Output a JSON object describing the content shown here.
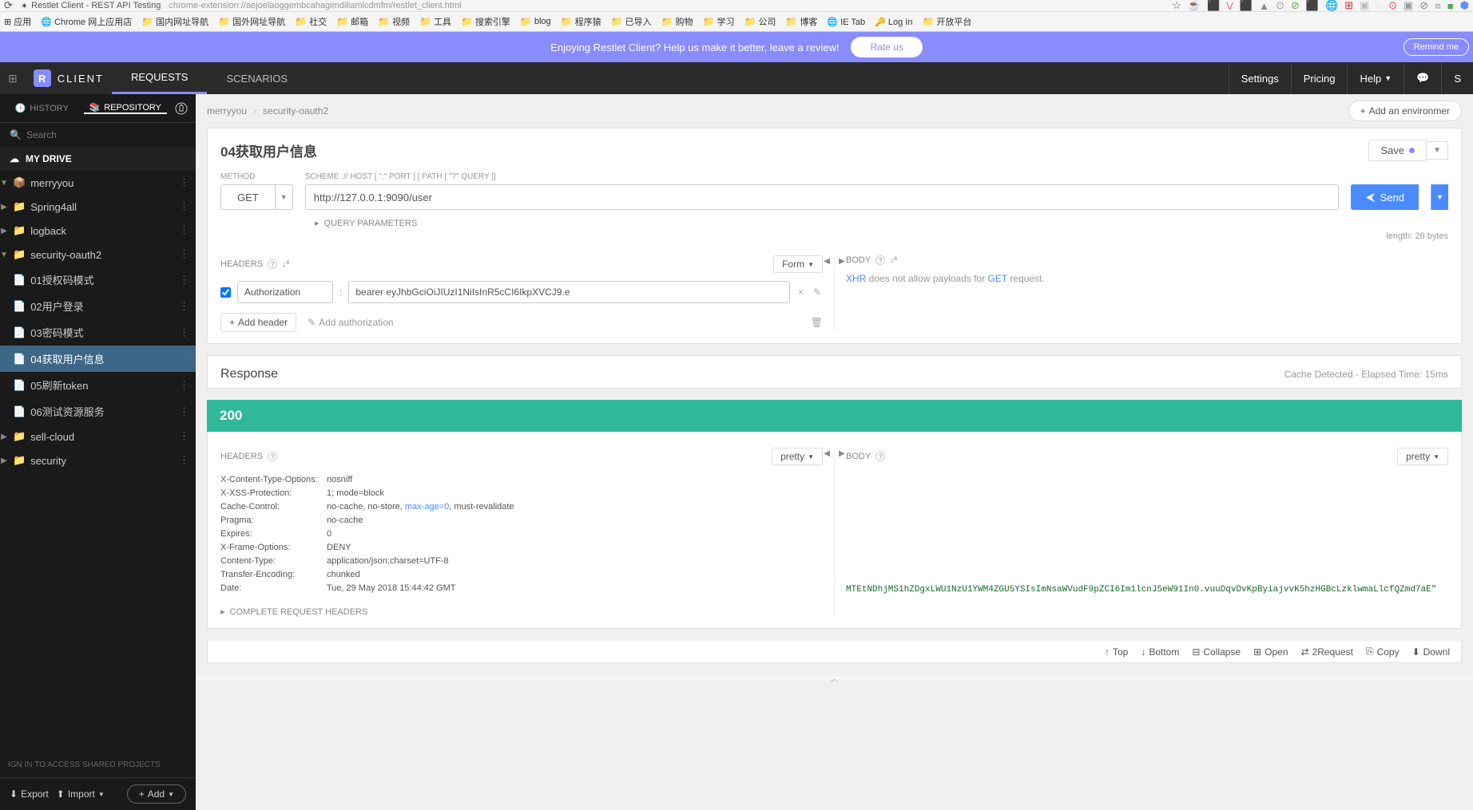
{
  "browser": {
    "title": "Restlet Client - REST API Testing",
    "url": "chrome-extension://aejoelaoggembcahagimdiliamlcdmfm/restlet_client.html"
  },
  "bookmarks": [
    {
      "icon": "apps",
      "label": "应用"
    },
    {
      "icon": "chrome",
      "label": "Chrome 网上应用店"
    },
    {
      "icon": "folder",
      "label": "国内网址导航"
    },
    {
      "icon": "folder",
      "label": "国外网址导航"
    },
    {
      "icon": "folder",
      "label": "社交"
    },
    {
      "icon": "folder",
      "label": "邮箱"
    },
    {
      "icon": "folder",
      "label": "视频"
    },
    {
      "icon": "folder",
      "label": "工具"
    },
    {
      "icon": "folder",
      "label": "搜索引擎"
    },
    {
      "icon": "folder",
      "label": "blog"
    },
    {
      "icon": "folder",
      "label": "程序猿"
    },
    {
      "icon": "folder",
      "label": "已导入"
    },
    {
      "icon": "folder",
      "label": "购物"
    },
    {
      "icon": "folder",
      "label": "学习"
    },
    {
      "icon": "folder",
      "label": "公司"
    },
    {
      "icon": "folder",
      "label": "博客"
    },
    {
      "icon": "ie",
      "label": "IE Tab"
    },
    {
      "icon": "login",
      "label": "Log In"
    },
    {
      "icon": "folder",
      "label": "开放平台"
    }
  ],
  "banner": {
    "text": "Enjoying Restlet Client? Help us make it better, leave a review!",
    "rate": "Rate us",
    "remind": "Remind me"
  },
  "topnav": {
    "client": "CLIENT",
    "tabs": [
      "REQUESTS",
      "SCENARIOS"
    ],
    "right": [
      "Settings",
      "Pricing",
      "Help"
    ]
  },
  "sidebar": {
    "history": "HISTORY",
    "repository": "REPOSITORY",
    "search_placeholder": "Search",
    "drive": "MY DRIVE",
    "signin": "IGN IN TO ACCESS SHARED PROJECTS",
    "export": "Export",
    "import": "Import",
    "add": "Add",
    "tree": [
      {
        "level": 1,
        "type": "proj",
        "label": "merryyou",
        "open": true
      },
      {
        "level": 2,
        "type": "folder",
        "label": "Spring4all",
        "open": false
      },
      {
        "level": 2,
        "type": "folder",
        "label": "logback",
        "open": false
      },
      {
        "level": 2,
        "type": "folder",
        "label": "security-oauth2",
        "open": true
      },
      {
        "level": 3,
        "type": "req",
        "label": "01授权码模式"
      },
      {
        "level": 3,
        "type": "req",
        "label": "02用户登录"
      },
      {
        "level": 3,
        "type": "req",
        "label": "03密码模式"
      },
      {
        "level": 3,
        "type": "req",
        "label": "04获取用户信息",
        "selected": true
      },
      {
        "level": 3,
        "type": "req",
        "label": "05刷新token"
      },
      {
        "level": 3,
        "type": "req",
        "label": "06测试资源服务"
      },
      {
        "level": 2,
        "type": "folder",
        "label": "sell-cloud",
        "open": false
      },
      {
        "level": 2,
        "type": "folder",
        "label": "security",
        "open": false
      }
    ]
  },
  "crumbs": {
    "project": "merryyou",
    "folder": "security-oauth2",
    "add_env": "Add an environmer"
  },
  "request": {
    "name": "04获取用户信息",
    "save": "Save",
    "method_label": "METHOD",
    "method": "GET",
    "url_label": "SCHEME :// HOST [ \":\" PORT ] [ PATH [ \"?\" QUERY ]]",
    "url": "http://127.0.0.1:9090/user",
    "send": "Send",
    "query_params": "QUERY PARAMETERS",
    "length": "length: 26 bytes",
    "headers_label": "HEADERS",
    "headers_mode": "Form",
    "body_label": "BODY",
    "header_name": "Authorization",
    "header_value": "bearer eyJhbGciOiJIUzI1NiIsInR5cCI6IkpXVCJ9.e",
    "add_header": "Add header",
    "add_auth": "Add authorization",
    "body_msg_xhr": "XHR",
    "body_msg_mid": " does not allow payloads for ",
    "body_msg_get": "GET",
    "body_msg_end": " request."
  },
  "response": {
    "title": "Response",
    "meta": "Cache Detected - Elapsed Time: 15ms",
    "status": "200",
    "headers_label": "HEADERS",
    "body_label": "BODY",
    "headers_mode": "pretty",
    "body_mode": "pretty",
    "complete": "COMPLETE REQUEST HEADERS",
    "headers": [
      {
        "k": "X-Content-Type-Options:",
        "v": "nosniff"
      },
      {
        "k": "X-XSS-Protection:",
        "v": "1; mode=block"
      },
      {
        "k": "Cache-Control:",
        "v": "no-cache, no-store, ",
        "link": "max-age=0",
        "v2": ", must-revalidate"
      },
      {
        "k": "Pragma:",
        "v": "no-cache"
      },
      {
        "k": "Expires:",
        "v": "0"
      },
      {
        "k": "X-Frame-Options:",
        "v": "DENY"
      },
      {
        "k": "Content-Type:",
        "v": "application/json;charset=UTF-8"
      },
      {
        "k": "Transfer-Encoding:",
        "v": "chunked"
      },
      {
        "k": "Date:",
        "v": "Tue, 29 May 2018 15:44:42 GMT"
      }
    ],
    "body": "MTEtNDhjMS1hZDgxLWU1NzU1YWM4ZGU5YSIsImNsaWVudF9pZCI6Im1lcnJ5eW91In0.vuuDqvDvKpByiajvvK5hzHGBcLzklwmaLlcfQZmd7aE\""
  },
  "bottom": {
    "top": "Top",
    "bottom": "Bottom",
    "collapse": "Collapse",
    "open": "Open",
    "tworeq": "2Request",
    "copy": "Copy",
    "download": "Downl"
  }
}
